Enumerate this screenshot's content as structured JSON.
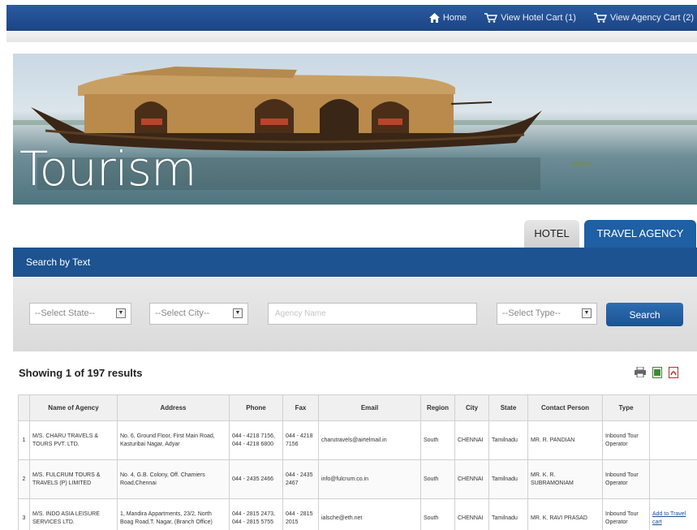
{
  "nav": {
    "home": "Home",
    "hotel_cart": "View Hotel Cart (1)",
    "agency_cart": "View Agency Cart (2)"
  },
  "banner": {
    "title": "Tourism"
  },
  "tabs": {
    "hotel": "HOTEL",
    "agency": "TRAVEL AGENCY"
  },
  "search": {
    "header": "Search by Text",
    "state": "--Select State--",
    "city": "--Select City--",
    "agency_placeholder": "Agency Name",
    "type": "--Select Type--",
    "button": "Search"
  },
  "results": {
    "count": "Showing 1 of 197 results",
    "columns": [
      "",
      "Name of Agency",
      "Address",
      "Phone",
      "Fax",
      "Email",
      "Region",
      "City",
      "State",
      "Contact Person",
      "Type",
      ""
    ],
    "rows": [
      {
        "n": "1",
        "name": "M/S. CHARU TRAVELS & TOURS PVT. LTD.",
        "address": "No. 6, Ground Floor, First Main Road, Kasturibai Nagar, Adyar",
        "phone": "044 - 4218 7156, 044 - 4218 6800",
        "fax": "044 - 4218 7156",
        "email": "charutravels@airtelmail.in",
        "region": "South",
        "city": "CHENNAI",
        "state": "Tamilnadu",
        "contact": "MR. R. PANDIAN",
        "type": "Inbound Tour Operator",
        "add": ""
      },
      {
        "n": "2",
        "name": "M/S. FULCRUM TOURS & TRAVELS (P) LIMITED",
        "address": "No. 4, G.B. Colony, Off. Chamiers Road,Chennai",
        "phone": "044 - 2435 2466",
        "fax": "044 - 2435 2467",
        "email": "info@fulcrum.co.in",
        "region": "South",
        "city": "CHENNAI",
        "state": "Tamilnadu",
        "contact": "MR. K. R. SUBRAMONIAM",
        "type": "Inbound Tour Operator",
        "add": ""
      },
      {
        "n": "3",
        "name": "M/S. INDO ASIA LEISURE SERVICES LTD.",
        "address": "1, Mandira Appartments, 23/2, North Boag Road,T. Nagar, (Branch Office)",
        "phone": "044 - 2815 2473, 044 - 2815 5755",
        "fax": "044 - 2815 2015",
        "email": "ialsche@eth.net",
        "region": "South",
        "city": "CHENNAI",
        "state": "Tamilnadu",
        "contact": "MR. K. RAVI PRASAD",
        "type": "Inbound Tour Operator",
        "add": "Add to Travel cart"
      }
    ]
  }
}
